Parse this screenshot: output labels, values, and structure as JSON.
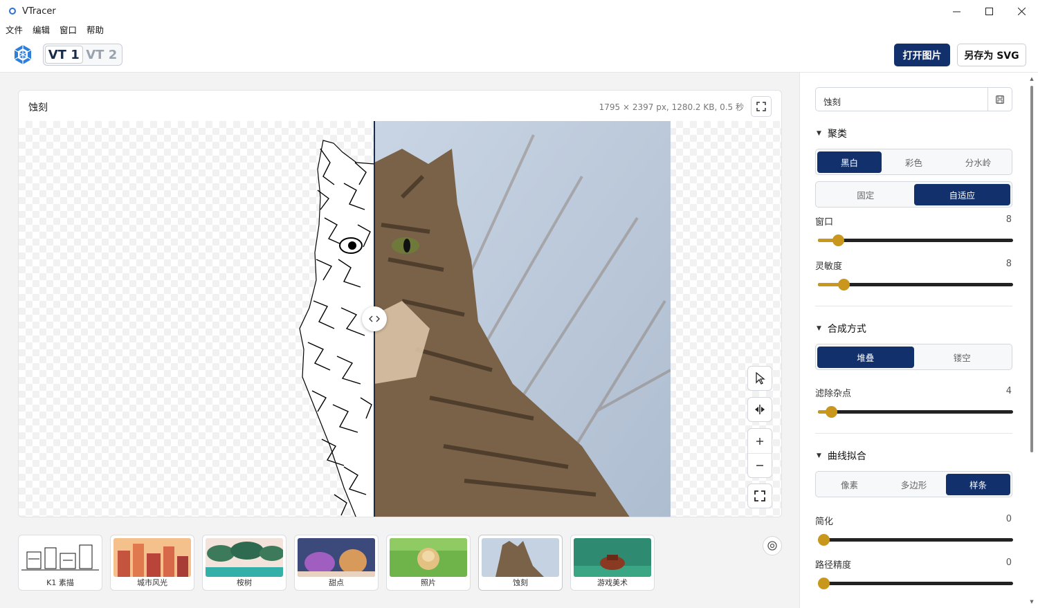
{
  "window": {
    "title": "VTracer"
  },
  "menu": [
    "文件",
    "编辑",
    "窗口",
    "帮助"
  ],
  "toolbar": {
    "vt1": "VT 1",
    "vt2": "VT 2",
    "open_label": "打开图片",
    "save_label": "另存为 SVG"
  },
  "canvas": {
    "title": "蚀刻",
    "info": "1795 × 2397 px, 1280.2 KB, 0.5 秒"
  },
  "thumbnails": [
    {
      "label": "K1 素描"
    },
    {
      "label": "城市风光"
    },
    {
      "label": "桉树"
    },
    {
      "label": "甜点"
    },
    {
      "label": "照片"
    },
    {
      "label": "蚀刻"
    },
    {
      "label": "游戏美术"
    }
  ],
  "panel": {
    "preset": "蚀刻",
    "clustering": {
      "title": "聚类",
      "mode_options": [
        "黑白",
        "彩色",
        "分水岭"
      ],
      "mode_selected": "黑白",
      "hier_options": [
        "固定",
        "自适应"
      ],
      "hier_selected": "自适应",
      "window": {
        "label": "窗口",
        "value": "8",
        "fraction": 0.08
      },
      "sensitivity": {
        "label": "灵敏度",
        "value": "8",
        "fraction": 0.11
      }
    },
    "compose": {
      "title": "合成方式",
      "options": [
        "堆叠",
        "镂空"
      ],
      "selected": "堆叠",
      "filter": {
        "label": "滤除杂点",
        "value": "4",
        "fraction": 0.04
      }
    },
    "curve": {
      "title": "曲线拟合",
      "options": [
        "像素",
        "多边形",
        "样条"
      ],
      "selected": "样条",
      "simplify": {
        "label": "简化",
        "value": "0",
        "fraction": 0.0
      },
      "precision": {
        "label": "路径精度",
        "value": "0",
        "fraction": 0.0
      }
    }
  },
  "colors": {
    "accent": "#12306b",
    "slider": "#c9971c"
  }
}
